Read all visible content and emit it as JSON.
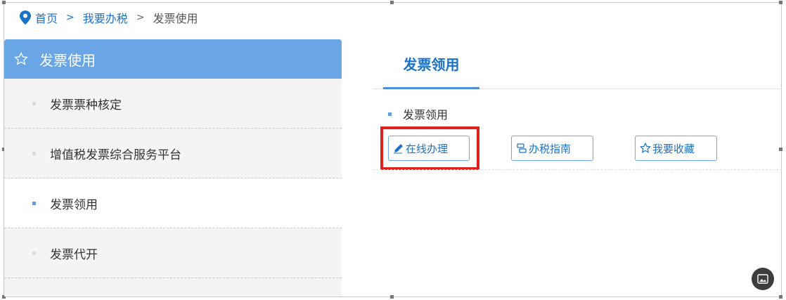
{
  "breadcrumb": {
    "home": "首页",
    "sep1": ">",
    "level2": "我要办税",
    "sep2": ">",
    "current": "发票使用"
  },
  "sidebar": {
    "header": "发票使用",
    "items": [
      {
        "label": "发票票种核定",
        "active": false
      },
      {
        "label": "增值税发票综合服务平台",
        "active": false
      },
      {
        "label": "发票领用",
        "active": true
      },
      {
        "label": "发票代开",
        "active": false
      }
    ]
  },
  "main": {
    "tab": "发票领用",
    "section_title": "发票领用",
    "buttons": {
      "online": "在线办理",
      "guide": "办税指南",
      "favorite": "我要收藏"
    }
  },
  "colors": {
    "accent": "#1a73c9",
    "sidebar_header": "#6aa6e6",
    "highlight": "#e0201b"
  },
  "icons": [
    "location-pin-icon",
    "star-outline-icon",
    "pencil-icon",
    "guide-icon",
    "star-icon",
    "image-icon"
  ]
}
